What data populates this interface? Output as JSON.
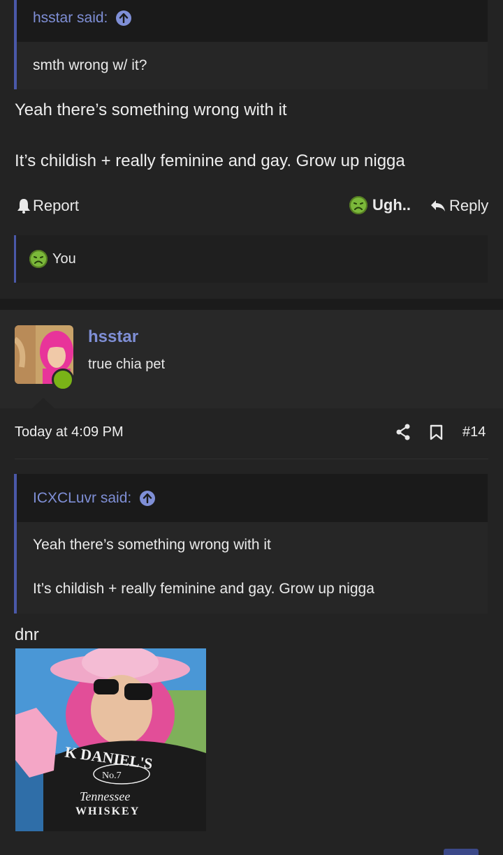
{
  "post1": {
    "quote": {
      "author_said": "hsstar said:",
      "text": "smth wrong w/ it?"
    },
    "line1": "Yeah there’s something wrong with it",
    "line2": "It’s childish + really feminine and gay. Grow up nigga",
    "actions": {
      "report": "Report",
      "reaction": "Ugh..",
      "reply": "Reply"
    },
    "reactions_bar": {
      "who": "You"
    }
  },
  "post2": {
    "author": "hsstar",
    "user_title": "true chia pet",
    "timestamp": "Today at 4:09 PM",
    "post_number": "#14",
    "quote": {
      "author_said": "ICXCLuvr said:",
      "line1": "Yeah there’s something wrong with it",
      "line2": "It’s childish + really feminine and gay. Grow up nigga"
    },
    "text": "dnr"
  },
  "colors": {
    "accent": "#7f8fd6",
    "online": "#7ab317",
    "reaction": "#7bb83a"
  }
}
